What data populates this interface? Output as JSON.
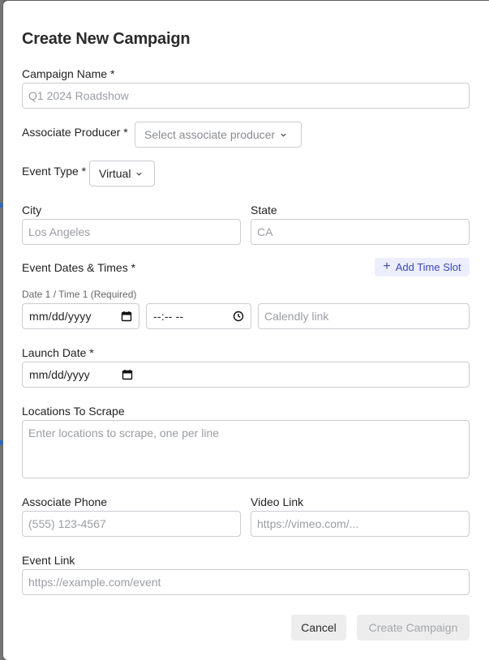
{
  "modal": {
    "title": "Create New Campaign"
  },
  "campaign_name": {
    "label": "Campaign Name *",
    "placeholder": "Q1 2024 Roadshow"
  },
  "associate_producer": {
    "label": "Associate Producer *",
    "selected": "Select associate producer"
  },
  "event_type": {
    "label": "Event Type *",
    "selected": "Virtual"
  },
  "city": {
    "label": "City",
    "placeholder": "Los Angeles"
  },
  "state": {
    "label": "State",
    "placeholder": "CA"
  },
  "event_dates": {
    "label": "Event Dates & Times *",
    "add_slot_label": "Add Time Slot",
    "slot_label": "Date 1 / Time 1 (Required)",
    "date_value": "mm/dd/yyyy",
    "time_value": "--:-- --",
    "calendly_placeholder": "Calendly link"
  },
  "launch_date": {
    "label": "Launch Date *",
    "value": "mm/dd/yyyy"
  },
  "locations": {
    "label": "Locations To Scrape",
    "placeholder": "Enter locations to scrape, one per line"
  },
  "associate_phone": {
    "label": "Associate Phone",
    "placeholder": "(555) 123-4567"
  },
  "video_link": {
    "label": "Video Link",
    "placeholder": "https://vimeo.com/..."
  },
  "event_link": {
    "label": "Event Link",
    "placeholder": "https://example.com/event"
  },
  "actions": {
    "cancel_label": "Cancel",
    "create_label": "Create Campaign"
  },
  "colors": {
    "accent": "#3d48b8",
    "accent_bg": "#eceefc",
    "border": "#c9ccd1",
    "backdrop": "#6b6b6b"
  }
}
